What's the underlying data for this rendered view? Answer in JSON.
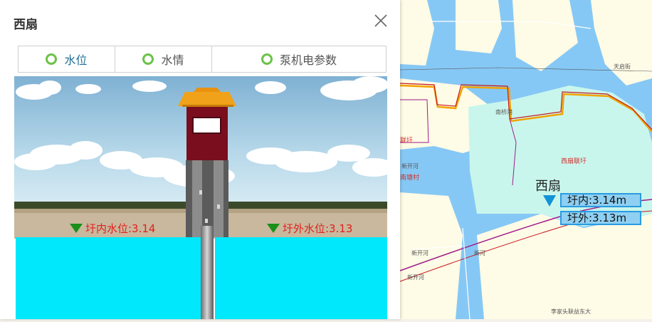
{
  "popup": {
    "title": "西扇",
    "tabs": [
      {
        "label": "水位",
        "active": true
      },
      {
        "label": "水情",
        "active": false
      },
      {
        "label": "泵机电参数",
        "active": false
      }
    ],
    "scene": {
      "inside_level_text": "圩内水位:3.14",
      "outside_level_text": "圩外水位:3.13"
    }
  },
  "map": {
    "station_name": "西扇",
    "inside_label": "圩内:3.14m",
    "outside_label": "圩外:3.13m",
    "labels": {
      "area_main": "西扇联圩",
      "area_left": "联圩",
      "village_left": "南塘村",
      "river_left": "新开河",
      "top_right": "天启街",
      "nan": "南桥港",
      "s1": "新开河",
      "s2": "新河",
      "s3": "新开河",
      "bottom": "李家头联益东大"
    },
    "colors": {
      "water": "#86c8f5",
      "land": "#fefbe6",
      "polder": "#c9f6ec",
      "boundary_red": "#c8181e",
      "boundary_purple": "#a01a8c",
      "road_orange": "#f1a300"
    }
  }
}
